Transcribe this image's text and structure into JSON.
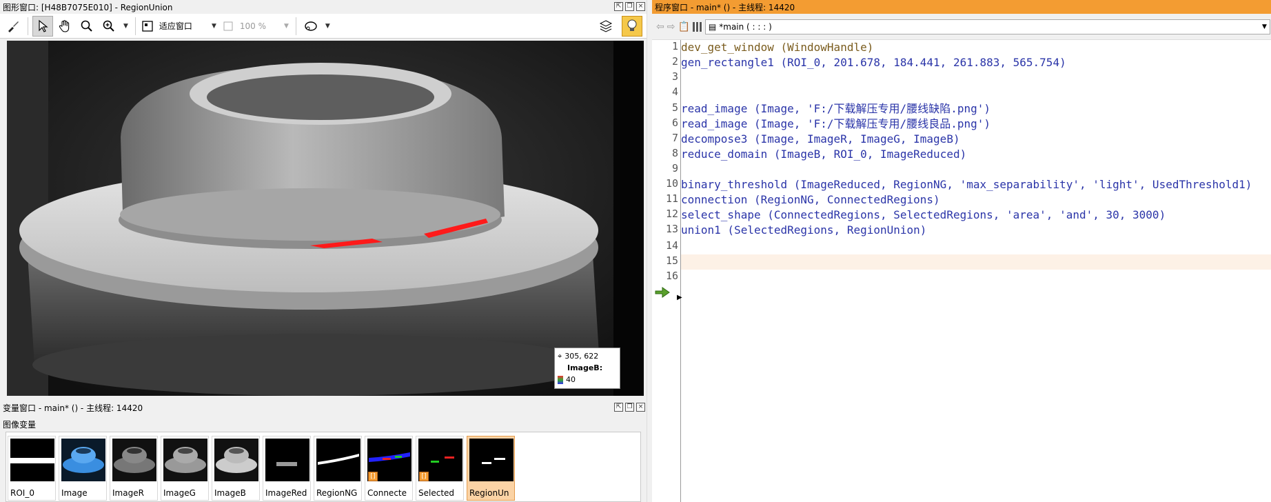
{
  "graphics_window": {
    "title": "图形窗口: [H48B7075E010] - RegionUnion",
    "toolbar": {
      "fit_label": "适应窗口",
      "zoom_label": "100 %"
    },
    "pixel_info": {
      "coords": "305, 622",
      "channel_label": "ImageB:",
      "value": "40"
    },
    "colors": {
      "region_overlay": "#ff1a1a"
    }
  },
  "variable_window": {
    "title": "变量窗口 - main* () - 主线程: 14420",
    "section_label": "图像变量",
    "items": [
      {
        "label": "ROI_0",
        "icon": "roi-thumbnail",
        "selected": false
      },
      {
        "label": "Image",
        "icon": "image-thumbnail",
        "selected": false
      },
      {
        "label": "ImageR",
        "icon": "image-thumbnail",
        "selected": false
      },
      {
        "label": "ImageG",
        "icon": "image-thumbnail",
        "selected": false
      },
      {
        "label": "ImageB",
        "icon": "image-thumbnail",
        "selected": false
      },
      {
        "label": "ImageRed",
        "icon": "image-thumbnail",
        "selected": false
      },
      {
        "label": "RegionNG",
        "icon": "region-thumbnail",
        "selected": false
      },
      {
        "label": "Connecte",
        "icon": "region-thumbnail",
        "selected": false,
        "badge": "[]"
      },
      {
        "label": "Selected",
        "icon": "region-thumbnail",
        "selected": false,
        "badge": "[]"
      },
      {
        "label": "RegionUn",
        "icon": "region-thumbnail",
        "selected": true
      }
    ]
  },
  "program_window": {
    "title": "程序窗口 - main* () - 主线程: 14420",
    "procedure": "*main ( : : : )",
    "lines": [
      {
        "num": "1",
        "op": "dev_get_window",
        "args": " (WindowHandle)",
        "kind": "op"
      },
      {
        "num": "2",
        "op": "gen_rectangle1",
        "args": " (ROI_0, 201.678, 184.441, 261.883, 565.754)",
        "kind": "call"
      },
      {
        "num": "3",
        "op": "",
        "args": "",
        "kind": "call"
      },
      {
        "num": "4",
        "op": "",
        "args": "",
        "kind": "call"
      },
      {
        "num": "5",
        "op": "read_image",
        "args": " (Image, 'F:/下载解压专用/腰线缺陷.png')",
        "kind": "call"
      },
      {
        "num": "6",
        "op": "read_image",
        "args": " (Image, 'F:/下载解压专用/腰线良品.png')",
        "kind": "call"
      },
      {
        "num": "7",
        "op": "decompose3",
        "args": " (Image, ImageR, ImageG, ImageB)",
        "kind": "call"
      },
      {
        "num": "8",
        "op": "reduce_domain",
        "args": " (ImageB, ROI_0, ImageReduced)",
        "kind": "call"
      },
      {
        "num": "9",
        "op": "",
        "args": "",
        "kind": "call"
      },
      {
        "num": "10",
        "op": "binary_threshold",
        "args": " (ImageReduced, RegionNG, 'max_separability', 'light', UsedThreshold1)",
        "kind": "call"
      },
      {
        "num": "11",
        "op": "connection",
        "args": " (RegionNG, ConnectedRegions)",
        "kind": "call"
      },
      {
        "num": "12",
        "op": "select_shape",
        "args": " (ConnectedRegions, SelectedRegions, 'area', 'and', 30, 3000)",
        "kind": "call"
      },
      {
        "num": "13",
        "op": "union1",
        "args": " (SelectedRegions, RegionUnion)",
        "kind": "call"
      },
      {
        "num": "14",
        "op": "",
        "args": "",
        "kind": "call"
      },
      {
        "num": "15",
        "op": "",
        "args": "",
        "kind": "call",
        "highlight": true
      },
      {
        "num": "16",
        "op": "",
        "args": "",
        "kind": "call"
      }
    ]
  }
}
